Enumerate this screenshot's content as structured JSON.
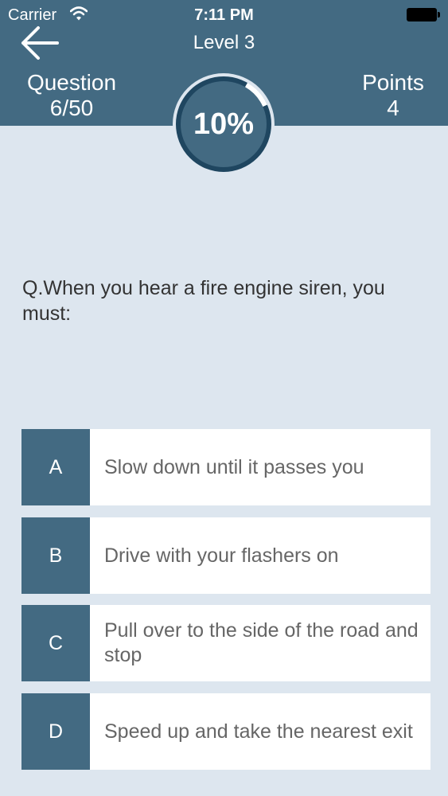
{
  "status_bar": {
    "carrier": "Carrier",
    "time": "7:11 PM"
  },
  "header": {
    "level": "Level 3",
    "question_label": "Question",
    "question_count": "6/50",
    "points_label": "Points",
    "points_value": "4",
    "progress_text": "10%",
    "progress_fraction": 0.1
  },
  "question": {
    "text": "Q.When you hear a fire engine siren, you must:"
  },
  "answers": [
    {
      "letter": "A",
      "text": "Slow down until it passes you"
    },
    {
      "letter": "B",
      "text": "Drive with your flashers on"
    },
    {
      "letter": "C",
      "text": "Pull over to the side of the road and stop"
    },
    {
      "letter": "D",
      "text": "Speed up and take the nearest exit"
    }
  ],
  "colors": {
    "header": "#436a82",
    "background": "#dde6ef",
    "ring_track": "#1f4660",
    "ring_progress": "#ffffff"
  },
  "icons": {
    "back": "arrow-left-icon",
    "wifi": "wifi-icon",
    "battery": "battery-icon"
  }
}
